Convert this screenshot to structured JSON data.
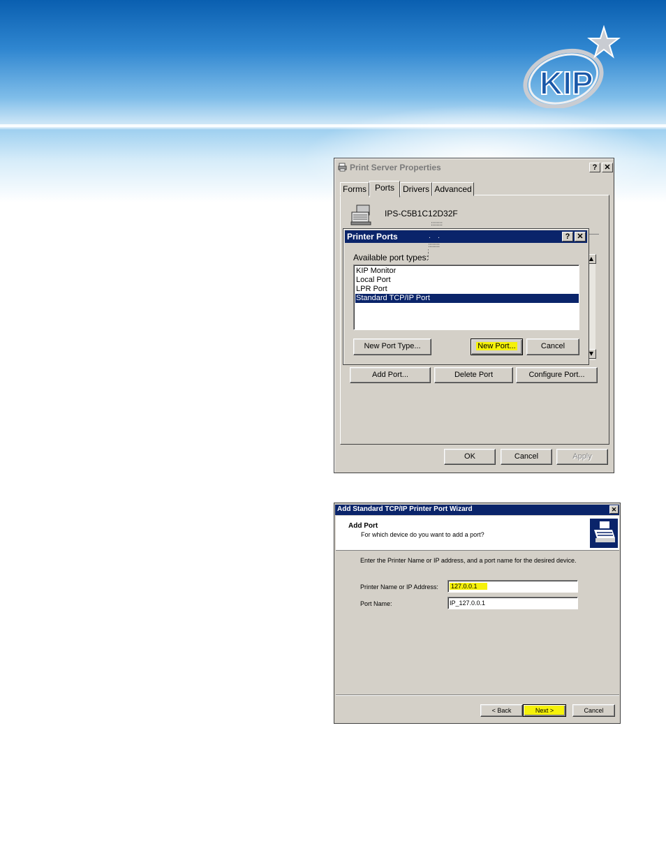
{
  "brand": {
    "logo_text": "KIP"
  },
  "print_server": {
    "title": "Print Server Properties",
    "help_btn": "?",
    "close_btn": "✕",
    "tabs": [
      {
        "label": "Forms",
        "active": false
      },
      {
        "label": "Ports",
        "active": true
      },
      {
        "label": "Drivers",
        "active": false
      },
      {
        "label": "Advanced",
        "active": false
      }
    ],
    "server_name": "IPS-C5B1C12D32F",
    "buttons": {
      "add_port": "Add Port...",
      "delete_port": "Delete Port",
      "configure_port": "Configure Port...",
      "ok": "OK",
      "cancel": "Cancel",
      "apply": "Apply"
    }
  },
  "printer_ports": {
    "title": "Printer Ports",
    "help_btn": "?",
    "close_btn": "✕",
    "label": "Available port types:",
    "port_types": [
      {
        "label": "KIP Monitor",
        "selected": false
      },
      {
        "label": "Local Port",
        "selected": false
      },
      {
        "label": "LPR Port",
        "selected": false
      },
      {
        "label": "Standard TCP/IP Port",
        "selected": true
      }
    ],
    "buttons": {
      "new_port_type": "New Port Type...",
      "new_port": "New Port...",
      "cancel": "Cancel"
    }
  },
  "wizard": {
    "title": "Add Standard TCP/IP Printer Port Wizard",
    "close_btn": "✕",
    "heading": "Add Port",
    "subheading": "For which device do you want to add a port?",
    "instruction": "Enter the Printer Name or IP address, and a port name for the desired device.",
    "ip_label": "Printer Name or IP Address:",
    "ip_value": "127.0.0.1",
    "port_label": "Port Name:",
    "port_value": "IP_127.0.0.1",
    "buttons": {
      "back": "< Back",
      "next": "Next >",
      "cancel": "Cancel"
    }
  },
  "colors": {
    "highlight": "#f5f10a",
    "titlebar_active": "#0a246a",
    "dialog_face": "#d4d0c8"
  }
}
